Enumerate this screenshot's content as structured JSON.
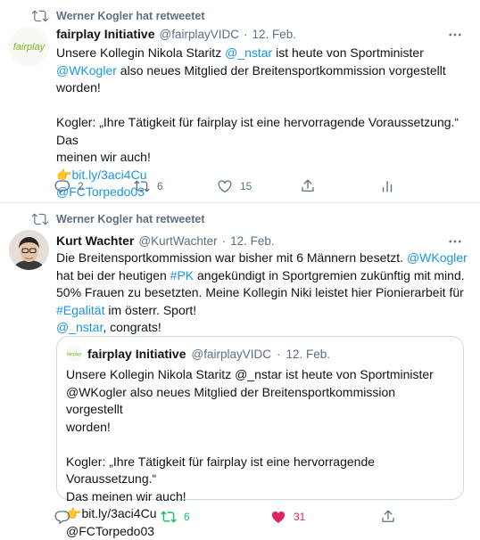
{
  "tweets": [
    {
      "retweet_label": "Werner Kogler hat retweetet",
      "author_name": "fairplay Initiative",
      "author_handle": "@fairplayVIDC",
      "separator": "·",
      "time": "12. Feb.",
      "avatar_text": "fairplay",
      "text": {
        "l1a": "Unsere Kollegin Nikola Staritz ",
        "l1b": "@_nstar",
        "l1c": " ist heute von Sportminister",
        "l2a": "@WKogler",
        "l2b": " also neues Mitglied der Breitensportkommission vorgestellt",
        "l3": "worden!",
        "l5": "Kogler: „Ihre Tätigkeit für fairplay ist eine hervorragende Voraussetzung.“ Das",
        "l6": "meinen wir auch!",
        "l7_emoji": "👉",
        "l7_link": "bit.ly/3aci4Cu",
        "l8": "@FCTorpedo03"
      },
      "actions": {
        "reply": "2",
        "retweet": "6",
        "like": "15"
      }
    },
    {
      "retweet_label": "Werner Kogler hat retweetet",
      "author_name": "Kurt Wachter",
      "author_handle": "@KurtWachter",
      "separator": "·",
      "time": "12. Feb.",
      "text": {
        "l1a": "Die Breitensportkommission war bisher mit 6 Männern besetzt. ",
        "l1b": "@WKogler",
        "l2a": "hat bei der heutigen ",
        "l2b": "#PK",
        "l2c": " angekündigt in Sportgremien zukünftig mit mind.",
        "l3": "50% Frauen zu besetzten. Meine Kollegin Niki leistet hier Pionierarbeit für",
        "l4a": "#Egalität",
        "l4b": " im österr. Sport!",
        "l5a": "@_nstar",
        "l5b": ", congrats!"
      },
      "quote": {
        "author_name": "fairplay Initiative",
        "author_handle": "@fairplayVIDC",
        "separator": "·",
        "time": "12. Feb.",
        "avatar_text": "fairplay",
        "l1": "Unsere Kollegin Nikola Staritz @_nstar ist heute von Sportminister",
        "l2": "@WKogler also neues Mitglied der Breitensportkommission vorgestellt",
        "l3": "worden!",
        "l5": "Kogler: „Ihre Tätigkeit für fairplay ist eine hervorragende Voraussetzung.“",
        "l6": "Das meinen wir auch!",
        "l7_emoji": "👉",
        "l7": "bit.ly/3aci4Cu",
        "l8": "@FCTorpedo03"
      },
      "actions": {
        "reply": "",
        "retweet": "6",
        "like": "31"
      }
    }
  ],
  "colors": {
    "link": "#1b95e0",
    "muted": "#5b7083",
    "retweet_active": "#17bf63",
    "like_active": "#e0245e",
    "fairplay_green": "#7ab51d"
  },
  "icons": [
    "retweet-icon",
    "more-icon",
    "reply-icon",
    "like-icon",
    "share-icon",
    "analytics-icon",
    "pointing-hand-emoji"
  ]
}
